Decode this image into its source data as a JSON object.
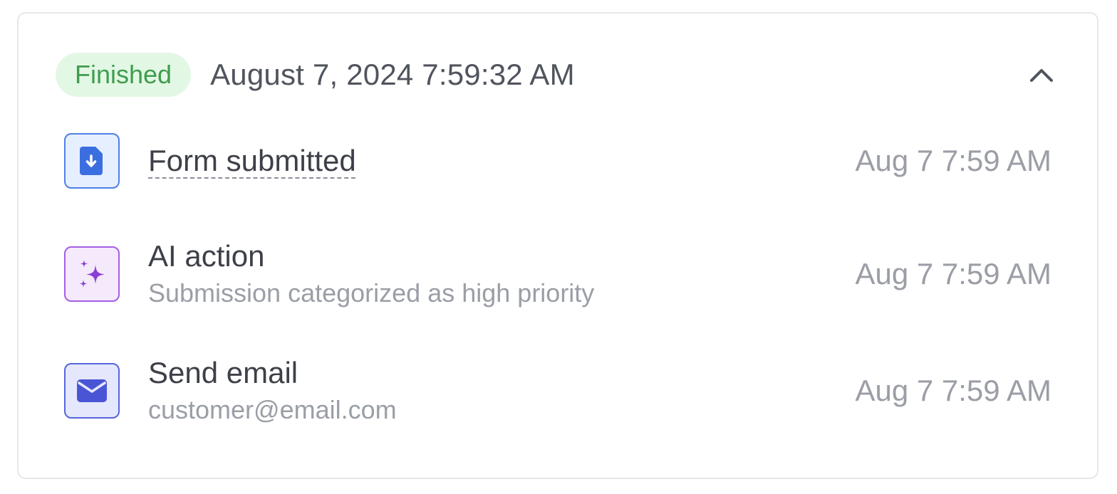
{
  "run": {
    "status": "Finished",
    "timestamp": "August 7, 2024 7:59:32 AM",
    "collapse_icon": "chevron-up-icon"
  },
  "steps": [
    {
      "title": "Form submitted",
      "subtitle": "",
      "time": "Aug 7 7:59 AM",
      "icon": "file-download-icon",
      "color": "#3b6fe0"
    },
    {
      "title": "AI action",
      "subtitle": "Submission categorized as high priority",
      "time": "Aug 7 7:59 AM",
      "icon": "sparkles-icon",
      "color": "#8a3fd6"
    },
    {
      "title": "Send email",
      "subtitle": "customer@email.com",
      "time": "Aug 7 7:59 AM",
      "icon": "mail-icon",
      "color": "#4a55d6"
    }
  ],
  "colors": {
    "status_bg": "#e3f7e5",
    "status_text": "#3f9d4d"
  }
}
